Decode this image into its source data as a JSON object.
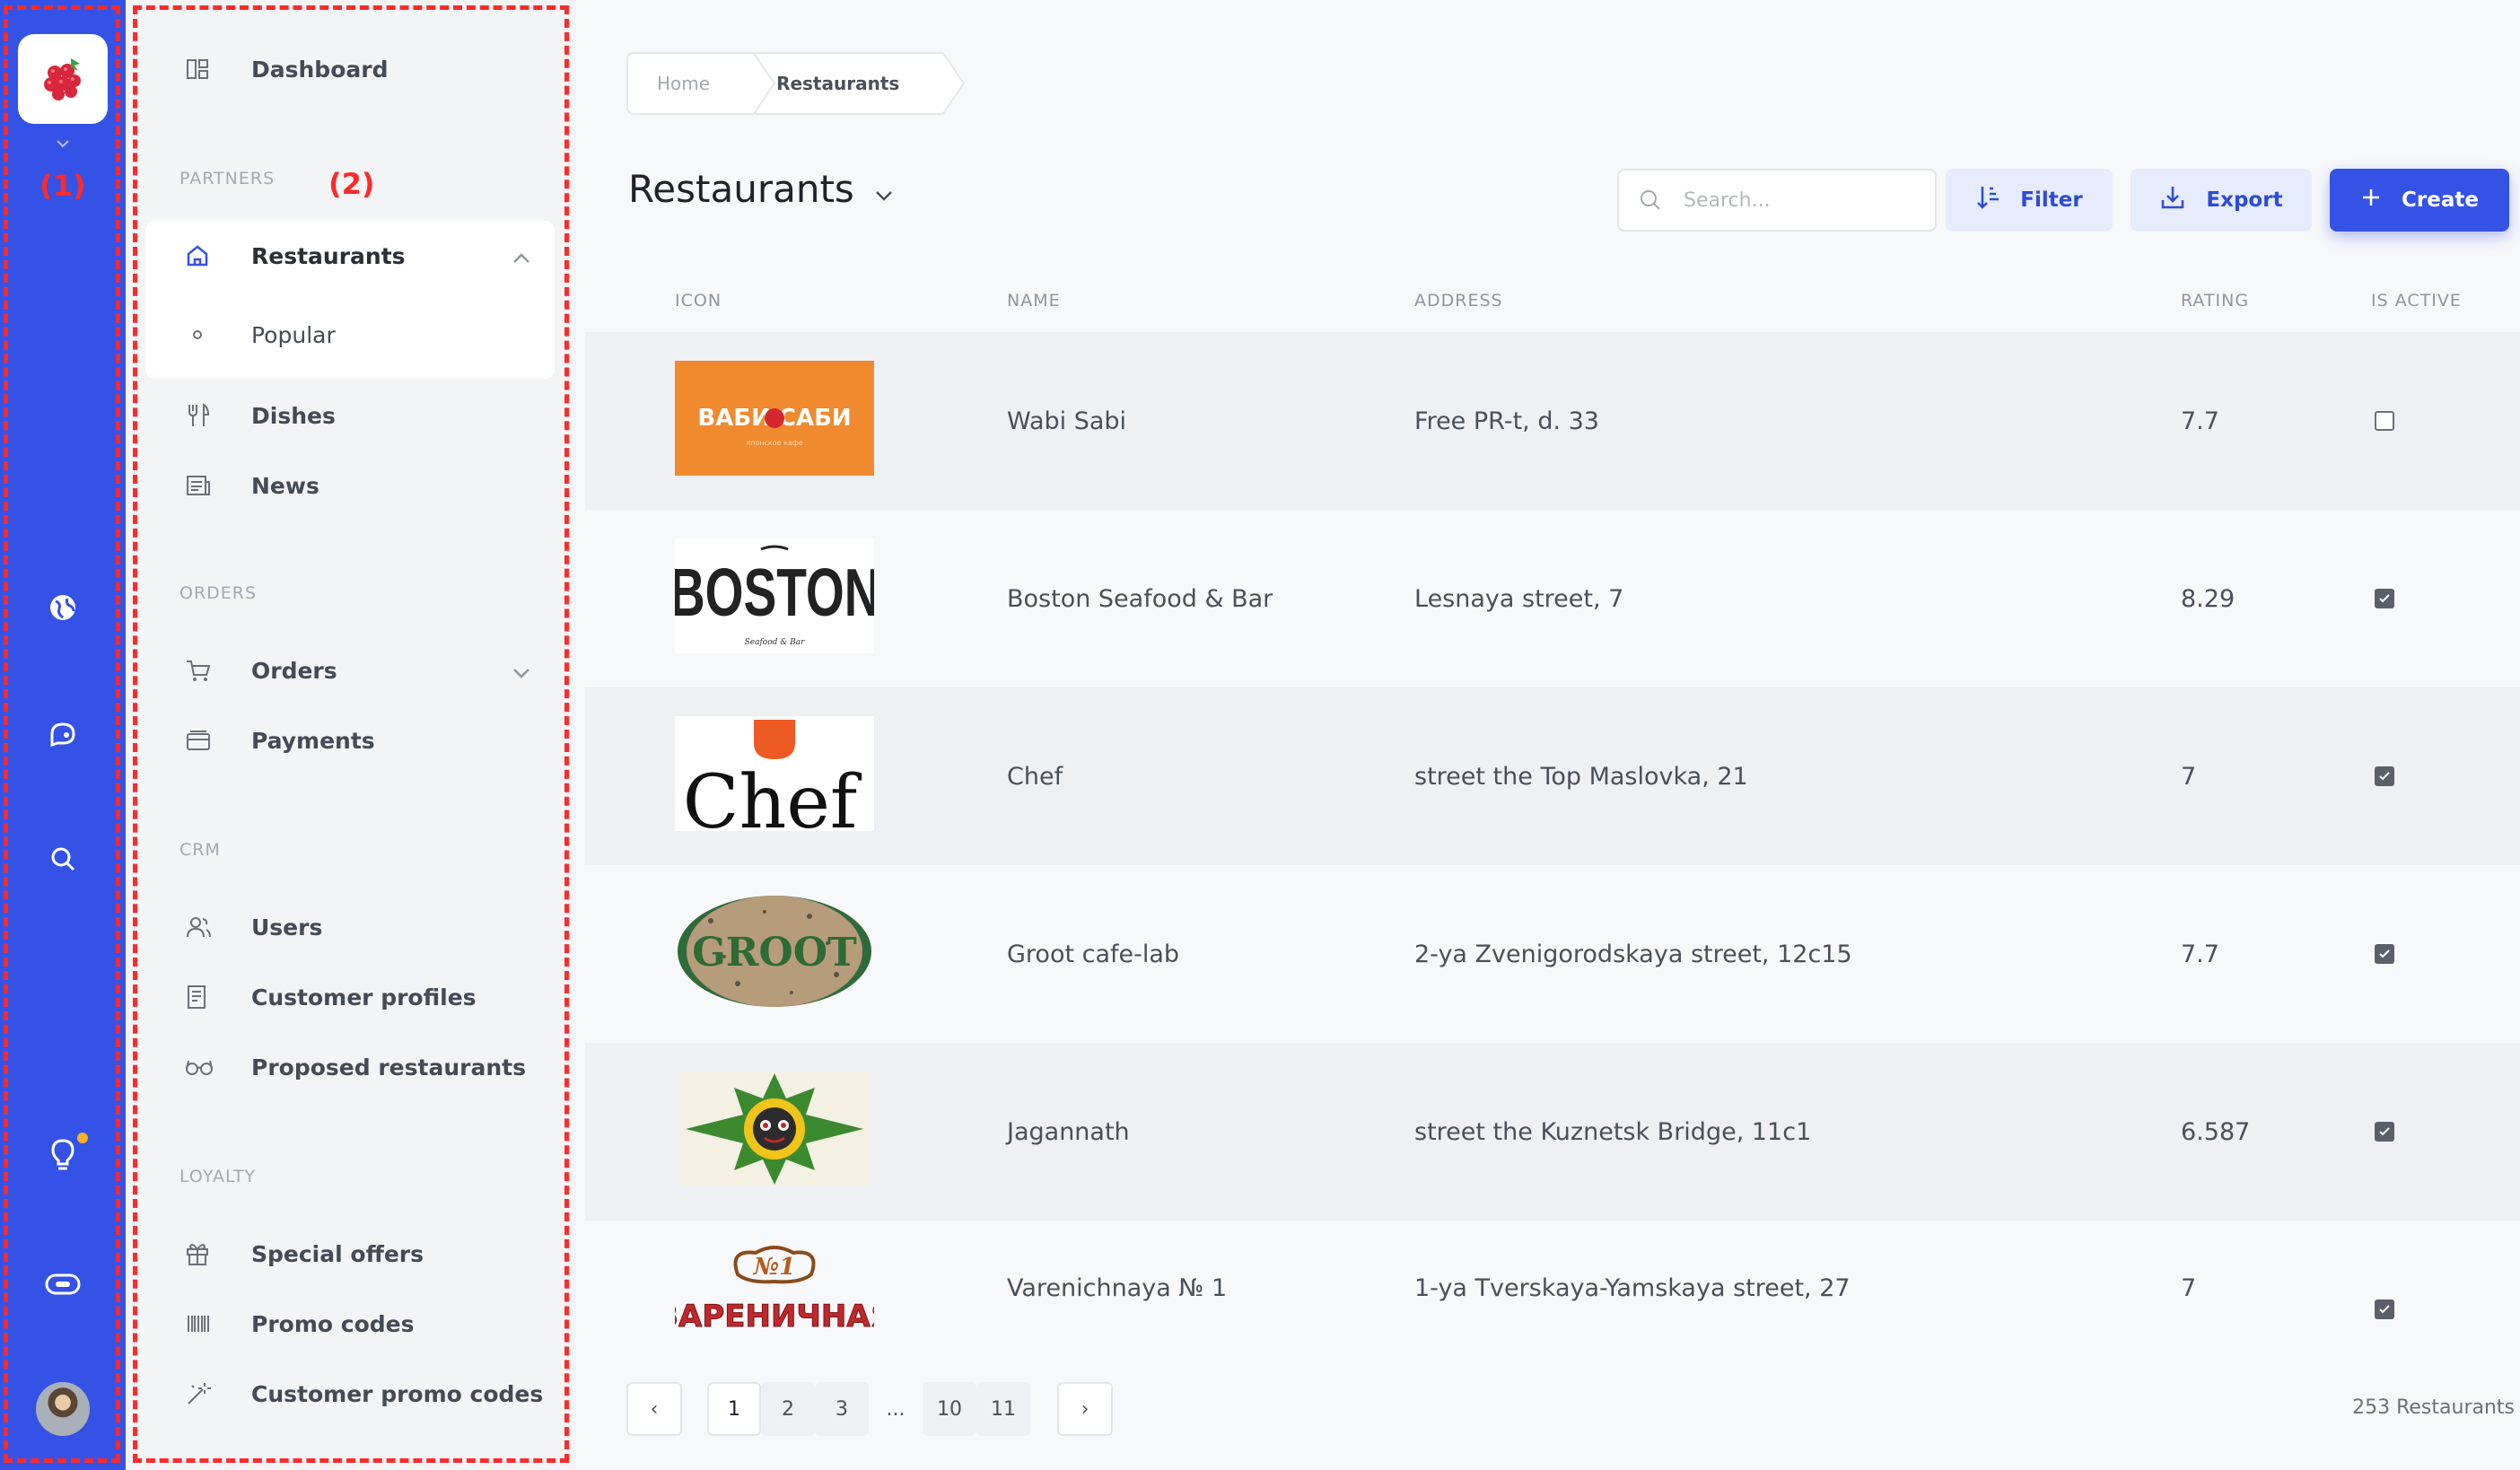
{
  "annotations": {
    "rail": "(1)",
    "sidebar": "(2)"
  },
  "rail": {
    "icons": [
      "raspberry-logo-icon",
      "globe-icon",
      "chat-icon",
      "search-icon",
      "lightbulb-icon",
      "toggle-icon"
    ],
    "notification_color": "#ffb020"
  },
  "sidebar": {
    "items": {
      "dashboard": "Dashboard",
      "restaurants": "Restaurants",
      "popular": "Popular",
      "dishes": "Dishes",
      "news": "News",
      "orders": "Orders",
      "payments": "Payments",
      "users": "Users",
      "customer_profiles": "Customer profiles",
      "proposed_restaurants": "Proposed restaurants",
      "special_offers": "Special offers",
      "promo_codes": "Promo codes",
      "customer_promo_codes": "Customer promo codes"
    },
    "sections": {
      "partners": "PARTNERS",
      "orders": "ORDERS",
      "crm": "CRM",
      "loyalty": "LOYALTY"
    }
  },
  "breadcrumb": {
    "home": "Home",
    "current": "Restaurants"
  },
  "page": {
    "title": "Restaurants"
  },
  "search": {
    "placeholder": "Search..."
  },
  "toolbar": {
    "filter": "Filter",
    "export": "Export",
    "create": "Create"
  },
  "table": {
    "headers": {
      "icon": "ICON",
      "name": "NAME",
      "address": "ADDRESS",
      "rating": "RATING",
      "active": "IS ACTIVE"
    },
    "rows": [
      {
        "name": "Wabi Sabi",
        "address": "Free PR-t, d. 33",
        "rating": "7.7",
        "active": false,
        "logo": {
          "text": "ВАБИ САБИ",
          "sub": "японское кафе"
        }
      },
      {
        "name": "Boston Seafood & Bar",
        "address": "Lesnaya street, 7",
        "rating": "8.29",
        "active": true,
        "logo": {
          "text": "BOSTON",
          "sub": "Seafood & Bar"
        }
      },
      {
        "name": "Chef",
        "address": "street the Top Maslovka, 21",
        "rating": "7",
        "active": true,
        "logo": {
          "text": "Chef"
        }
      },
      {
        "name": "Groot cafe-lab",
        "address": "2-ya Zvenigorodskaya street, 12c15",
        "rating": "7.7",
        "active": true,
        "logo": {
          "text": "GROOT"
        }
      },
      {
        "name": "Jagannath",
        "address": "street the Kuznetsk Bridge, 11c1",
        "rating": "6.587",
        "active": true,
        "logo": {
          "text": ""
        }
      },
      {
        "name": "Varenichnaya № 1",
        "address": "1-ya Tverskaya-Yamskaya street, 27",
        "rating": "7",
        "active": true,
        "logo": {
          "text": "ВАРЕНИЧНАЯ",
          "badge": "№1"
        }
      }
    ]
  },
  "pagination": {
    "prev": "‹",
    "next": "›",
    "pages": [
      "1",
      "2",
      "3",
      "...",
      "10",
      "11"
    ],
    "current": "1",
    "total": "253 Restaurants"
  },
  "colors": {
    "accent": "#3552e6",
    "annotation": "#ff2a2a"
  }
}
